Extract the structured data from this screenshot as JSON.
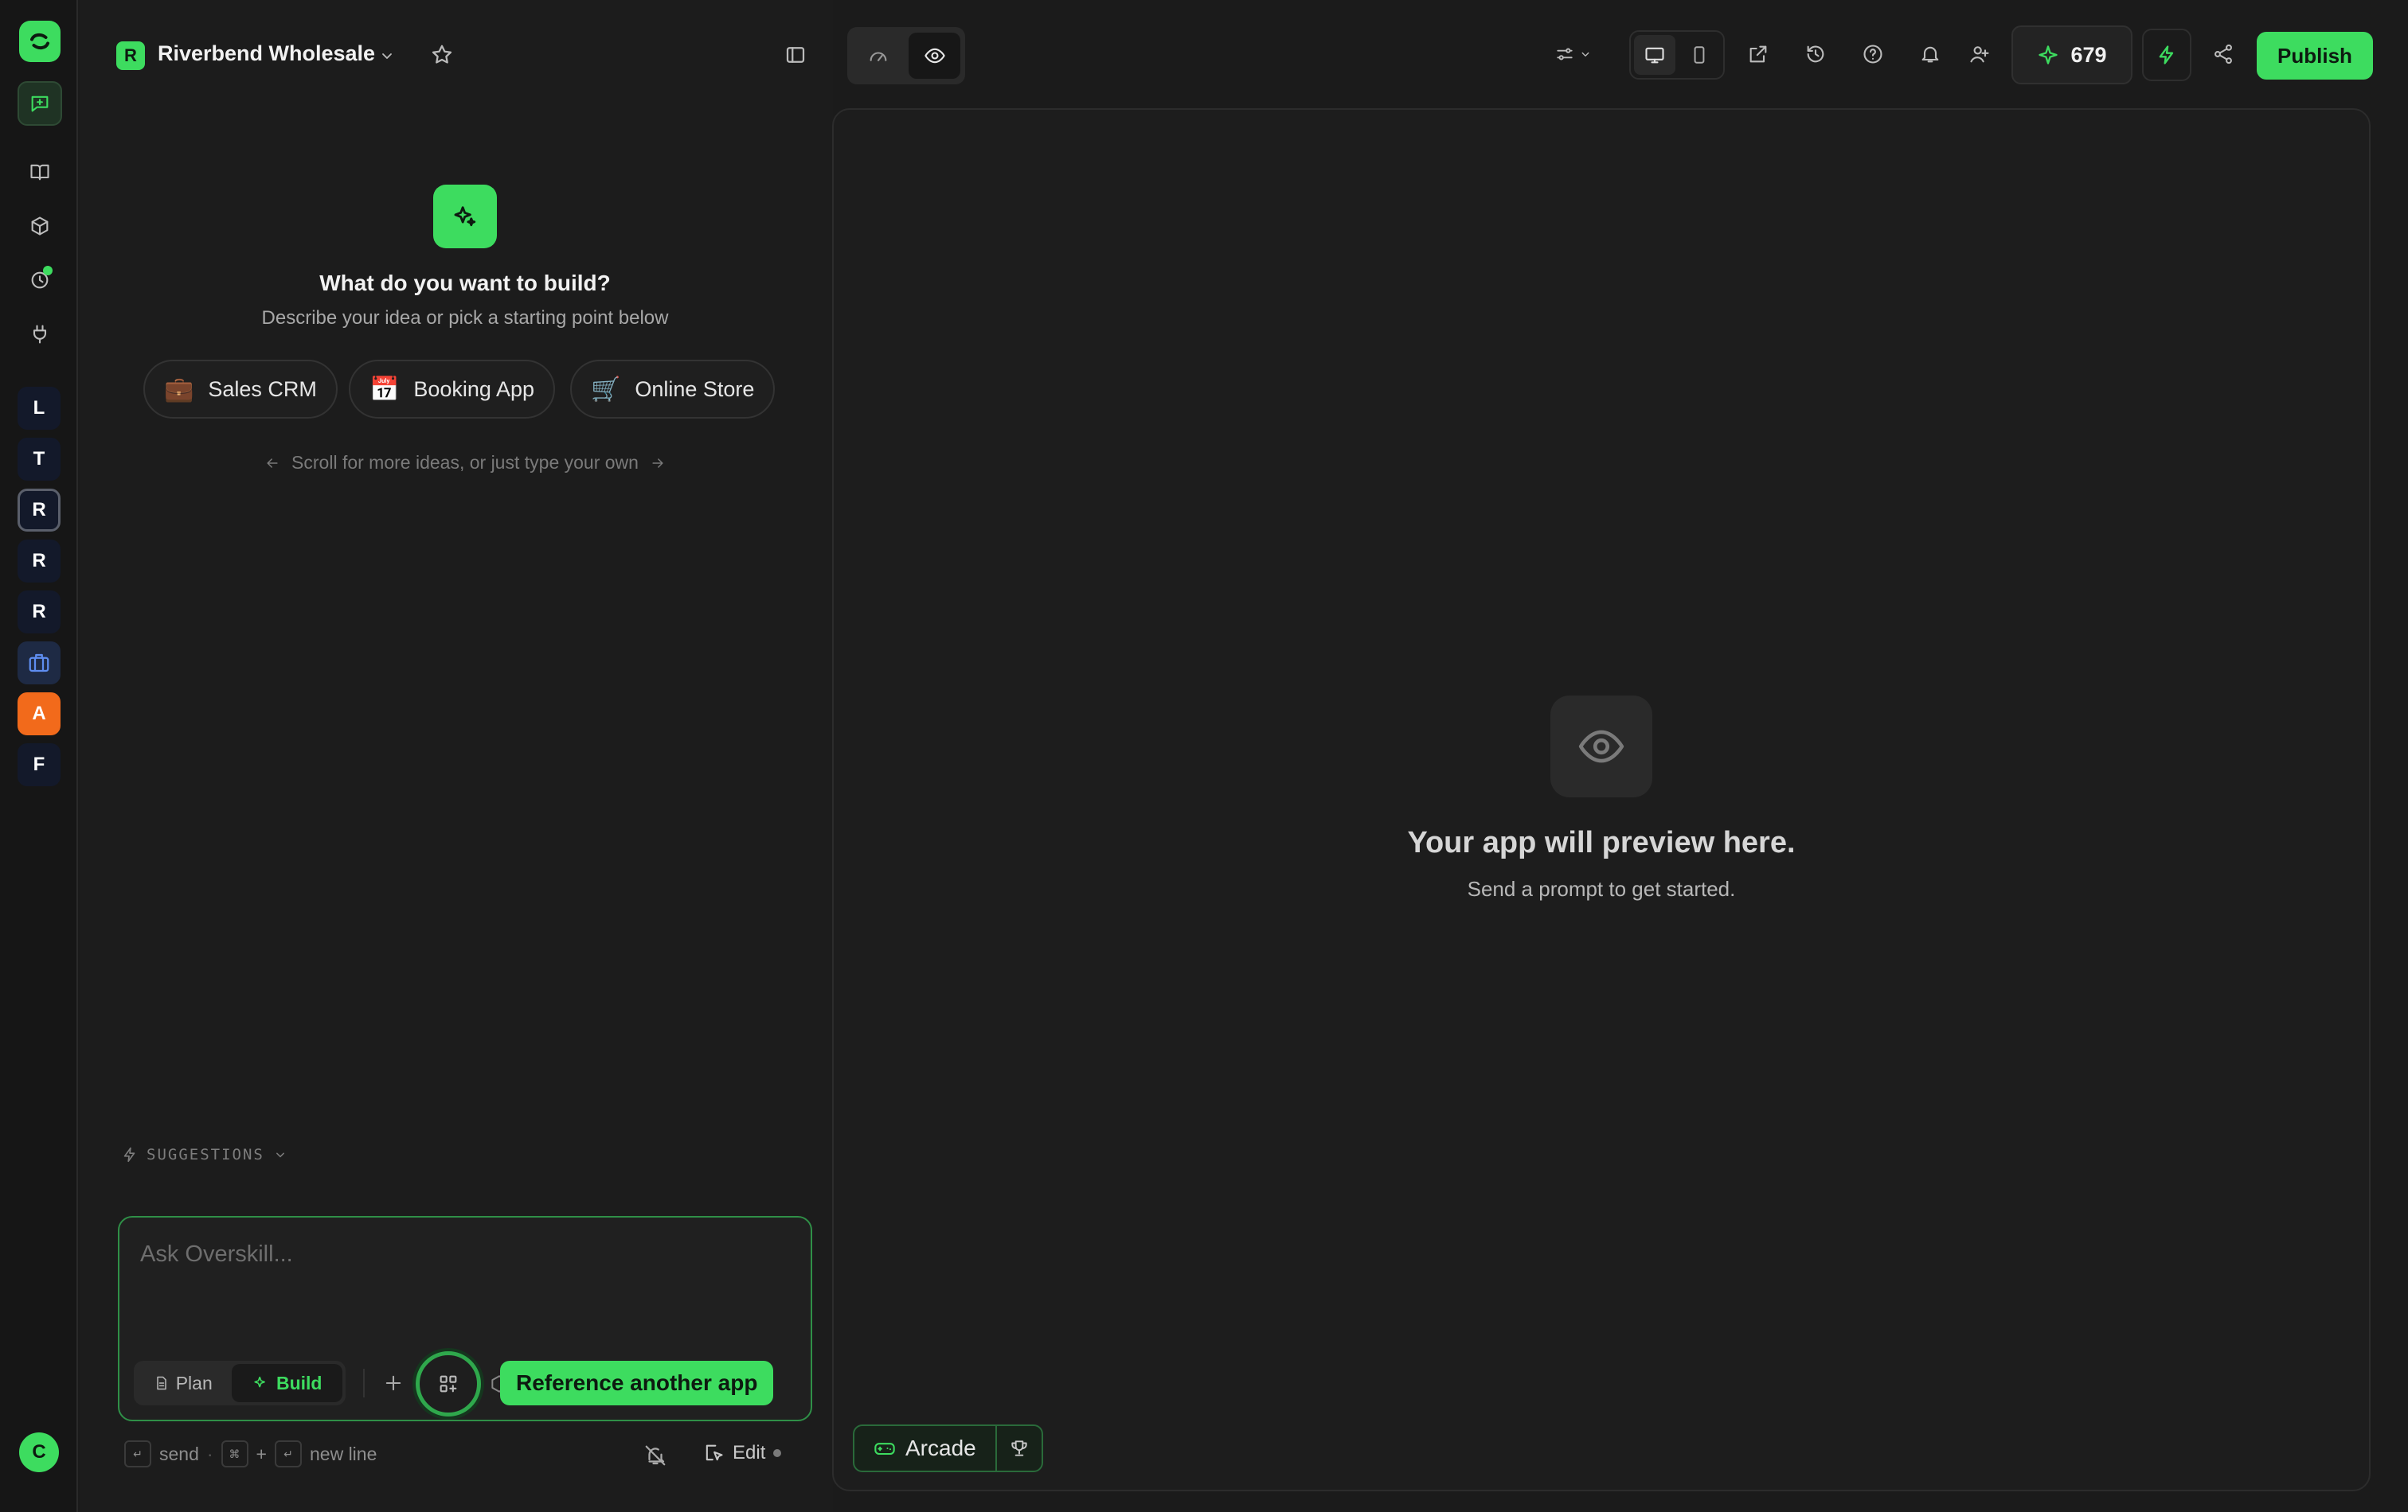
{
  "project": {
    "initial": "R",
    "name": "Riverbend Wholesale"
  },
  "workspaces": [
    "L",
    "T",
    "R",
    "R",
    "R",
    "A",
    "F"
  ],
  "user_initial": "C",
  "colors": {
    "accent": "#3ddc5f",
    "bg": "#1c1c1c",
    "rail": "#161616"
  },
  "empty_state": {
    "title": "What do you want to build?",
    "subtitle": "Describe your idea or pick a starting point below",
    "chips": [
      {
        "emoji": "💼",
        "label": "Sales CRM"
      },
      {
        "emoji": "📅",
        "label": "Booking App"
      },
      {
        "emoji": "🛒",
        "label": "Online Store"
      }
    ],
    "scroll_hint": "Scroll for more ideas, or just type your own"
  },
  "suggestions_label": "SUGGESTIONS",
  "composer": {
    "placeholder": "Ask Overskill...",
    "plan_label": "Plan",
    "build_label": "Build",
    "tooltip": "Reference another app"
  },
  "footer": {
    "enter_key": "↵",
    "send": "send",
    "cmd_key": "⌘",
    "plus": "+",
    "newline": "new line",
    "edit": "Edit"
  },
  "topbar": {
    "credits": "679",
    "publish": "Publish"
  },
  "preview": {
    "title": "Your app will preview here.",
    "subtitle": "Send a prompt to get started."
  },
  "arcade": {
    "label": "Arcade"
  }
}
